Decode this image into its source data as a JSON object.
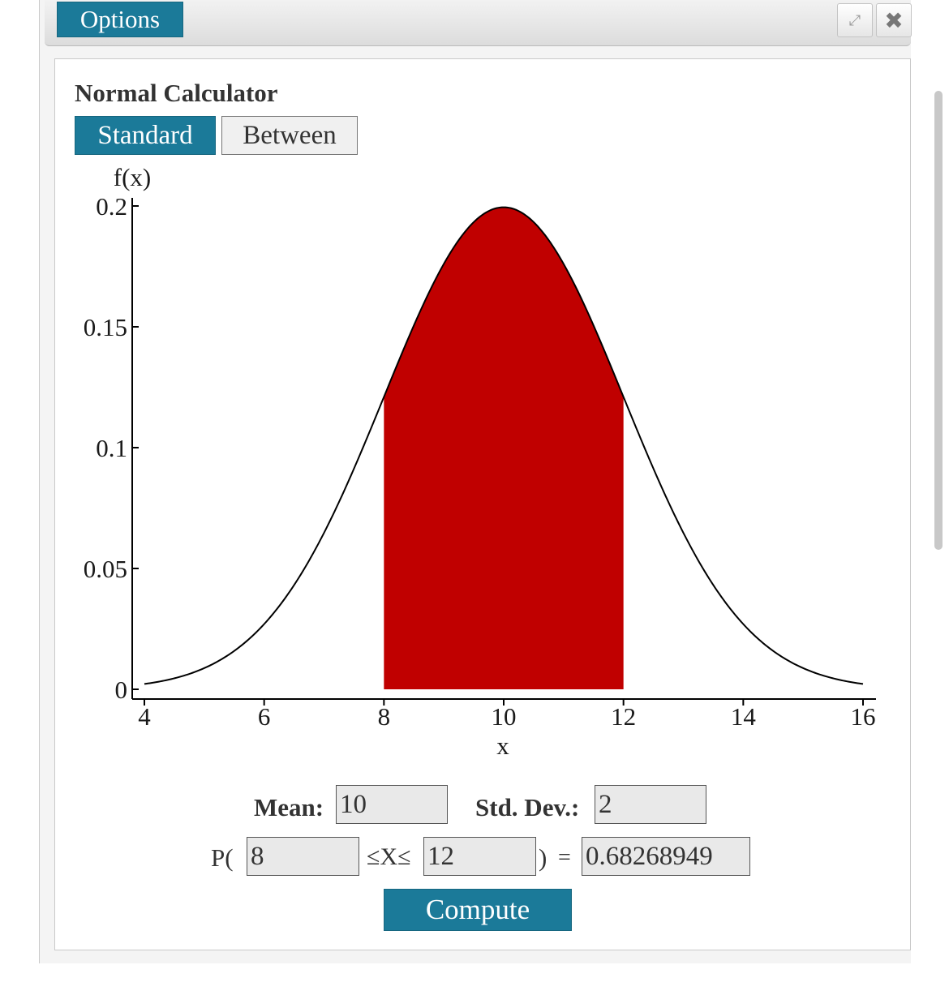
{
  "window": {
    "options_label": "Options",
    "expand_icon": "expand-icon",
    "close_icon": "close-icon"
  },
  "calculator": {
    "heading": "Normal Calculator",
    "tabs": [
      {
        "label": "Standard",
        "active": true
      },
      {
        "label": "Between",
        "active": false
      }
    ]
  },
  "chart_data": {
    "type": "area",
    "distribution": "normal",
    "mean": 10,
    "sd": 2,
    "shade_range": [
      8,
      12
    ],
    "xlim": [
      4,
      16
    ],
    "ylim": [
      0,
      0.2
    ],
    "xticks": [
      "4",
      "6",
      "8",
      "10",
      "12",
      "14",
      "16"
    ],
    "yticks": [
      "0",
      "0.05",
      "0.1",
      "0.15",
      "0.2"
    ],
    "xlabel": "x",
    "ylabel": "f(x)",
    "shade_color": "#c00000",
    "curve_color": "#000000"
  },
  "inputs": {
    "mean_label": "Mean:",
    "mean_value": "10",
    "sd_label": "Std. Dev.:",
    "sd_value": "2",
    "prob_open": "P(",
    "lower_value": "8",
    "between_symbol": "≤X≤",
    "upper_value": "12",
    "prob_close": ")",
    "equals": "=",
    "result_value": "0.68268949",
    "compute_label": "Compute"
  },
  "colors": {
    "accent": "#1b7a99"
  }
}
